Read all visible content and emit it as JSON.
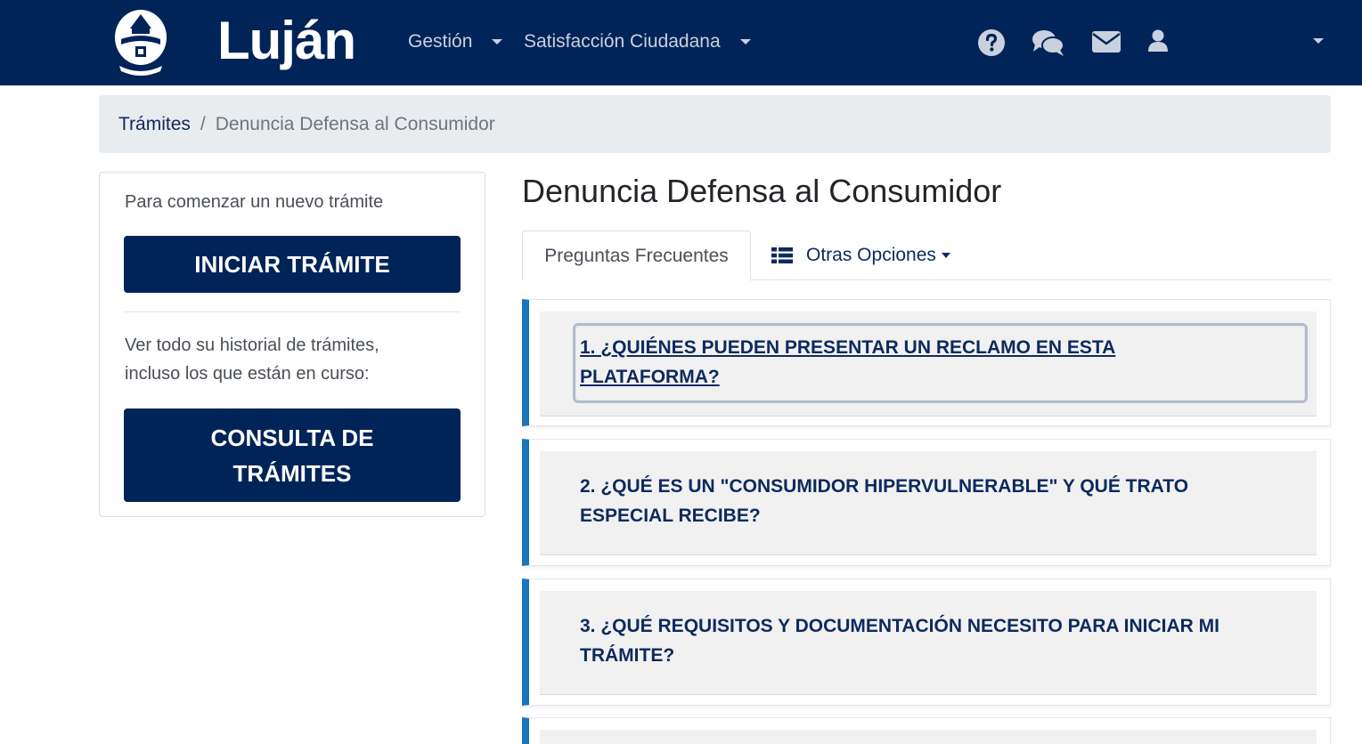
{
  "navbar": {
    "brand": "Luján",
    "menu": [
      {
        "label": "Gestión"
      },
      {
        "label": "Satisfacción Ciudadana"
      }
    ],
    "icons": [
      "help-icon",
      "chat-icon",
      "mail-icon",
      "user-icon"
    ],
    "colors": {
      "background": "#002458",
      "text": "#c9d1df"
    }
  },
  "breadcrumb": {
    "link": "Trámites",
    "separator": "/",
    "current": "Denuncia Defensa al Consumidor"
  },
  "sidebar": {
    "intro_text": "Para comenzar un nuevo trámite",
    "start_button": "INICIAR TRÁMITE",
    "history_text_1": "Ver todo su historial de trámites,",
    "history_text_2": "incluso los que están en curso:",
    "query_button_1": "CONSULTA DE",
    "query_button_2": "TRÁMITES"
  },
  "main": {
    "title": "Denuncia Defensa al Consumidor",
    "tabs": {
      "active": "Preguntas Frecuentes",
      "dropdown": "Otras Opciones"
    },
    "faqs": [
      {
        "line1": "1. ¿QUIÉNES PUEDEN PRESENTAR UN RECLAMO EN ESTA",
        "line2": "PLATAFORMA?"
      },
      {
        "line1": "2. ¿QUÉ ES UN \"CONSUMIDOR HIPERVULNERABLE\" Y QUÉ TRATO",
        "line2": "ESPECIAL RECIBE?"
      },
      {
        "line1": "3. ¿QUÉ REQUISITOS Y DOCUMENTACIÓN NECESITO PARA INICIAR MI",
        "line2": "TRÁMITE?"
      }
    ]
  },
  "colors": {
    "accent": "#1a75bb",
    "primary_dark": "#002458"
  }
}
